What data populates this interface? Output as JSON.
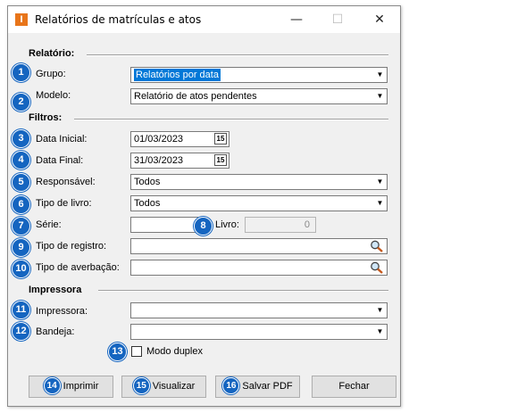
{
  "window": {
    "title": "Relatórios de matrículas e atos",
    "app_icon": "I"
  },
  "titlebar_buttons": {
    "minimize": "—",
    "maximize": "☐",
    "close": "✕"
  },
  "sections": {
    "relatorio": "Relatório:",
    "filtros": "Filtros:",
    "impressora": "Impressora"
  },
  "labels": {
    "grupo": "Grupo:",
    "modelo": "Modelo:",
    "data_inicial": "Data Inicial:",
    "data_final": "Data Final:",
    "responsavel": "Responsável:",
    "tipo_livro": "Tipo de livro:",
    "serie": "Série:",
    "livro": "Livro:",
    "tipo_registro": "Tipo de registro:",
    "tipo_averbacao": "Tipo de averbação:",
    "impressora": "Impressora:",
    "bandeja": "Bandeja:",
    "modo_duplex": "Modo duplex"
  },
  "values": {
    "grupo": "Relatórios por data",
    "modelo": "Relatório de atos pendentes",
    "data_inicial": "01/03/2023",
    "data_final": "31/03/2023",
    "responsavel": "Todos",
    "tipo_livro": "Todos",
    "serie": "",
    "livro": "0",
    "tipo_registro": "",
    "tipo_averbacao": "",
    "impressora": "",
    "bandeja": ""
  },
  "calendar_glyph": "15",
  "badges": [
    "1",
    "2",
    "3",
    "4",
    "5",
    "6",
    "7",
    "8",
    "9",
    "10",
    "11",
    "12",
    "13",
    "14",
    "15",
    "16"
  ],
  "buttons": {
    "imprimir": "Imprimir",
    "visualizar": "Visualizar",
    "salvar_pdf": "Salvar PDF",
    "fechar": "Fechar"
  },
  "colors": {
    "badge": "#1565c0",
    "selection": "#0078d7",
    "app_icon": "#e8751a"
  }
}
